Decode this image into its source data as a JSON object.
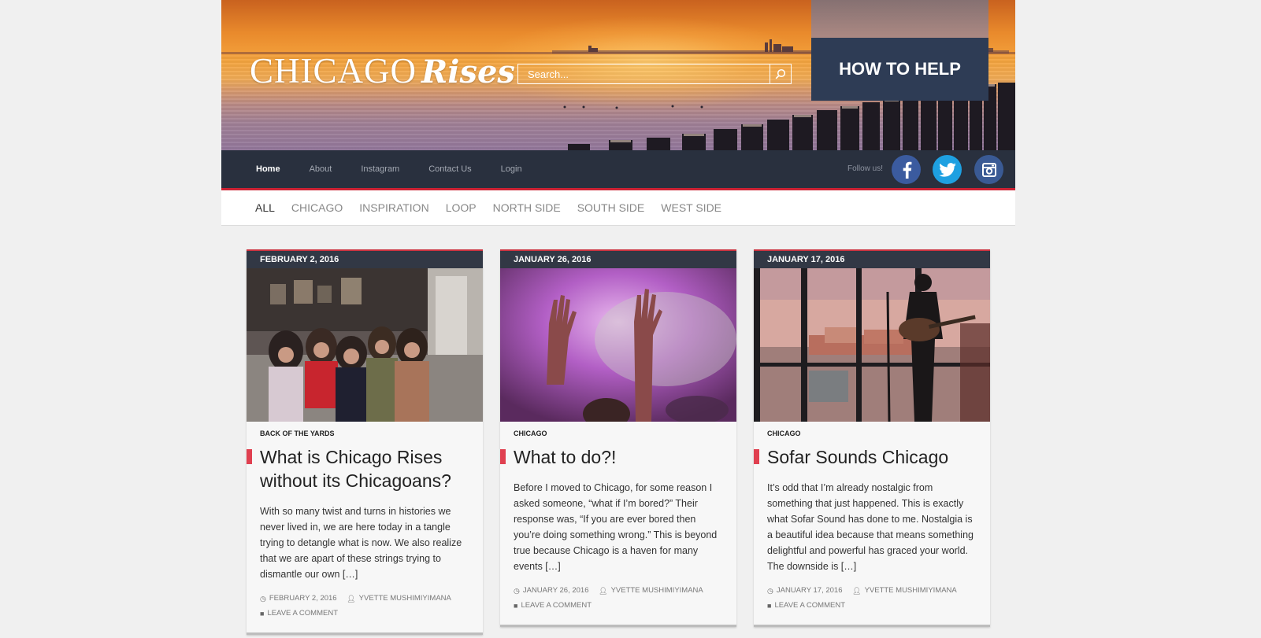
{
  "header": {
    "logo_word1": "CHICAGO",
    "logo_word2": "Rises",
    "search_placeholder": "Search...",
    "help_label": "HOW TO HELP"
  },
  "nav": {
    "items": [
      {
        "label": "Home",
        "active": true
      },
      {
        "label": "About"
      },
      {
        "label": "Instagram"
      },
      {
        "label": "Contact Us"
      },
      {
        "label": "Login"
      }
    ],
    "follow_label": "Follow us!",
    "social": [
      "facebook-icon",
      "twitter-icon",
      "instagram-icon"
    ]
  },
  "categories": [
    "ALL",
    "CHICAGO",
    "INSPIRATION",
    "LOOP",
    "NORTH SIDE",
    "SOUTH SIDE",
    "WEST SIDE"
  ],
  "posts": [
    {
      "date": "FEBRUARY 2, 2016",
      "category": "BACK OF THE YARDS",
      "title": "What is Chicago Rises without its Chicagoans?",
      "excerpt": "With so many twist and turns in histories we never lived in, we are here today in a tangle trying to detangle what is now. We also realize that we are apart of these strings trying to dismantle our own […]",
      "meta_date": "FEBRUARY 2, 2016",
      "author": "YVETTE MUSHIMIYIMANA",
      "comment": "LEAVE A COMMENT"
    },
    {
      "date": "JANUARY 26, 2016",
      "category": "CHICAGO",
      "title": "What to do?!",
      "excerpt": "Before I moved to Chicago, for some reason I asked someone, “what if I’m bored?” Their response was, “If you are ever bored then you’re doing something wrong.” This is beyond true because Chicago is a haven for many events […]",
      "meta_date": "JANUARY 26, 2016",
      "author": "YVETTE MUSHIMIYIMANA",
      "comment": "LEAVE A COMMENT"
    },
    {
      "date": "JANUARY 17, 2016",
      "category": "CHICAGO",
      "title": "Sofar Sounds Chicago",
      "excerpt": "It’s odd that I’m already nostalgic from something that just happened. This is exactly what Sofar Sound has done to me. Nostalgia is a beautiful idea because that means something delightful and powerful has graced your world. The downside is […]",
      "meta_date": "JANUARY 17, 2016",
      "author": "YVETTE MUSHIMIYIMANA",
      "comment": "LEAVE A COMMENT"
    }
  ],
  "colors": {
    "nav_bg": "#29303e",
    "accent_red": "#cc2233",
    "help_bg": "#2e3c55",
    "facebook": "#3b5b9f",
    "twitter": "#1ea0e1",
    "instagram": "#3a5a94"
  }
}
